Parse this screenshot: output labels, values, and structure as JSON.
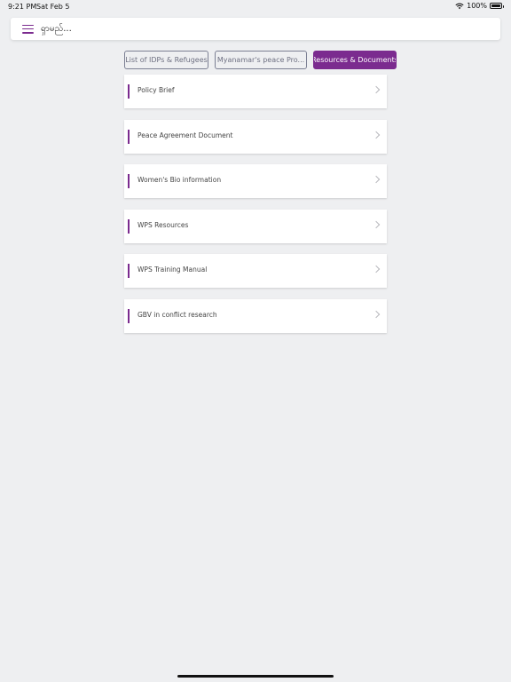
{
  "status_bar": {
    "time": "9:21 PM",
    "date": "Sat Feb 5",
    "battery": "100%",
    "battery_level": 1.0
  },
  "search": {
    "menu_icon": "hamburger-icon",
    "text": "ရှာမည်..."
  },
  "tabs": [
    {
      "label": "List of IDPs & Refugees",
      "active": false
    },
    {
      "label": "Myanamar's peace Pro...",
      "active": false
    },
    {
      "label": "Resources & Documents",
      "active": true
    }
  ],
  "items": [
    {
      "label": "Policy Brief"
    },
    {
      "label": "Peace Agreement Document"
    },
    {
      "label": "Women's Bio information"
    },
    {
      "label": "WPS Resources"
    },
    {
      "label": "WPS Training Manual"
    },
    {
      "label": "GBV in conflict research"
    }
  ],
  "colors": {
    "accent": "#7b2b8f",
    "background": "#eeeff1",
    "card": "#ffffff",
    "tab_border": "#7b7f93"
  }
}
